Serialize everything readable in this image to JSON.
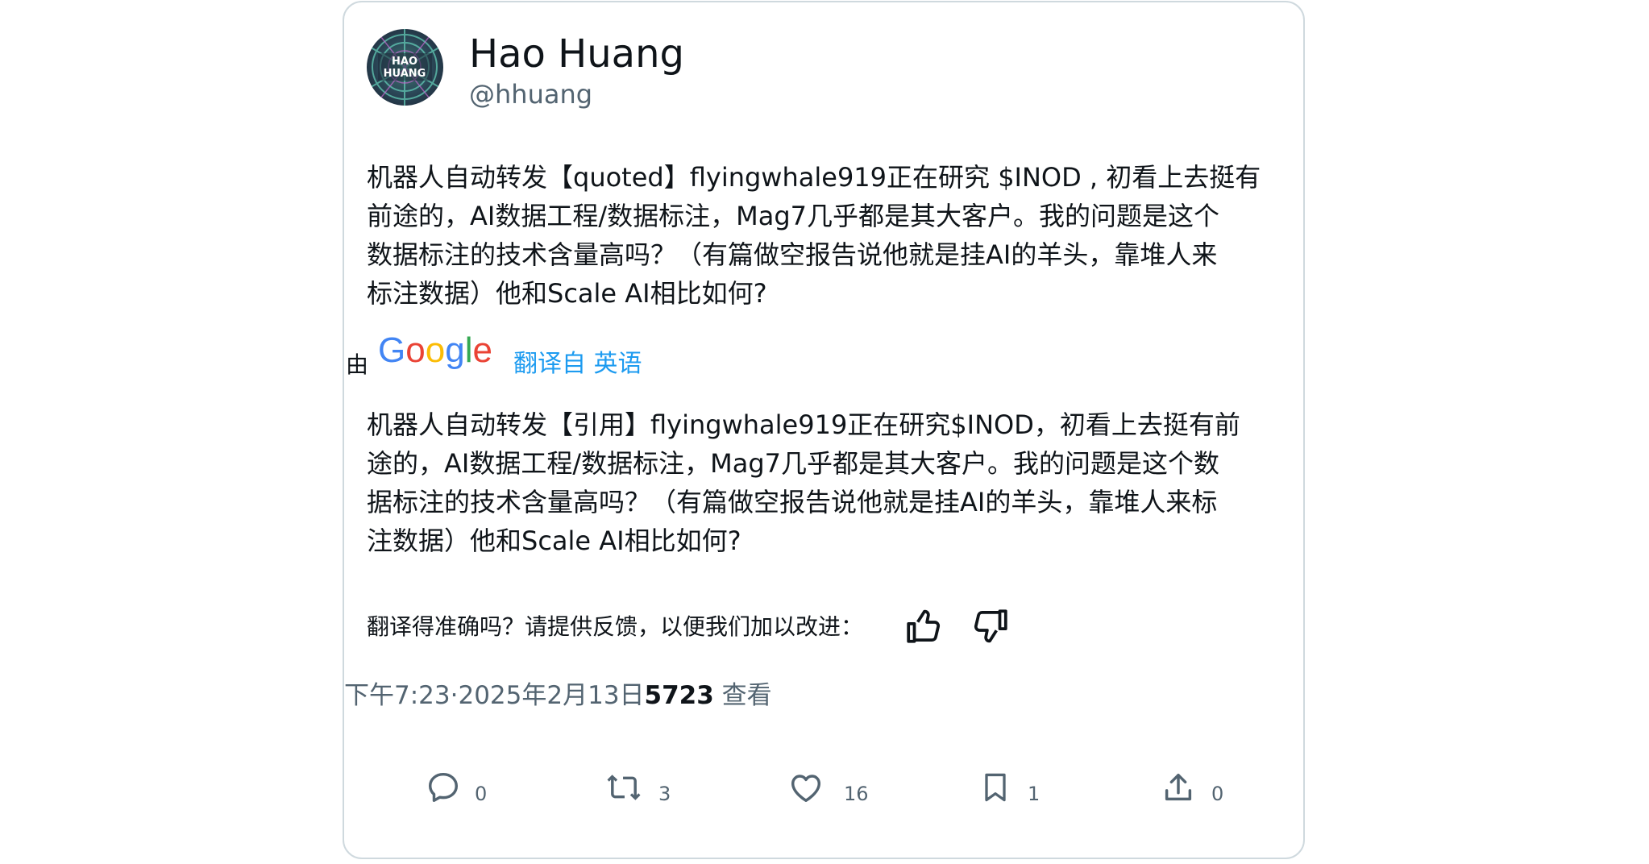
{
  "author": {
    "display_name": "Hao Huang",
    "handle": "@hhuang",
    "avatar_text": "HAO HUANG",
    "avatar_icon": "avatar-icon"
  },
  "tweet": {
    "original_lines": [
      "机器人自动转发【quoted】flyingwhale919正在研究 $INOD , 初看上去挺有",
      "前途的，AI数据工程/数据标注，Mag7几乎都是其大客户。我的问题是这个",
      "数据标注的技术含量高吗？（有篇做空报告说他就是挂AI的羊头，靠堆人来",
      "标注数据）他和Scale AI相比如何?"
    ],
    "translation": {
      "by_label": "由",
      "provider": "Google",
      "link_text": "翻译自 英语",
      "lines": [
        "机器人自动转发【引用】flyingwhale919正在研究$INOD，初看上去挺有前",
        "途的，AI数据工程/数据标注，Mag7几乎都是其大客户。我的问题是这个数",
        "据标注的技术含量高吗？（有篇做空报告说他就是挂AI的羊头，靠堆人来标",
        "注数据）他和Scale AI相比如何?"
      ]
    },
    "feedback": {
      "prompt": "翻译得准确吗？请提供反馈，以便我们加以改进：",
      "thumbs_up_icon": "thumbs-up-icon",
      "thumbs_down_icon": "thumbs-down-icon"
    },
    "meta": {
      "time": "下午7:23",
      "separator": "·",
      "date": "2025年2月13日",
      "views_count": "5723",
      "views_label": " 查看"
    },
    "actions": {
      "reply": {
        "icon": "reply-icon",
        "count": "0"
      },
      "retweet": {
        "icon": "retweet-icon",
        "count": "3"
      },
      "like": {
        "icon": "heart-icon",
        "count": "16"
      },
      "bookmark": {
        "icon": "bookmark-icon",
        "count": "1"
      },
      "share": {
        "icon": "share-icon",
        "count": "0"
      }
    }
  },
  "colors": {
    "text_primary": "#0f1419",
    "text_secondary": "#536471",
    "link": "#1d9bf0",
    "border": "#cfd9de"
  }
}
